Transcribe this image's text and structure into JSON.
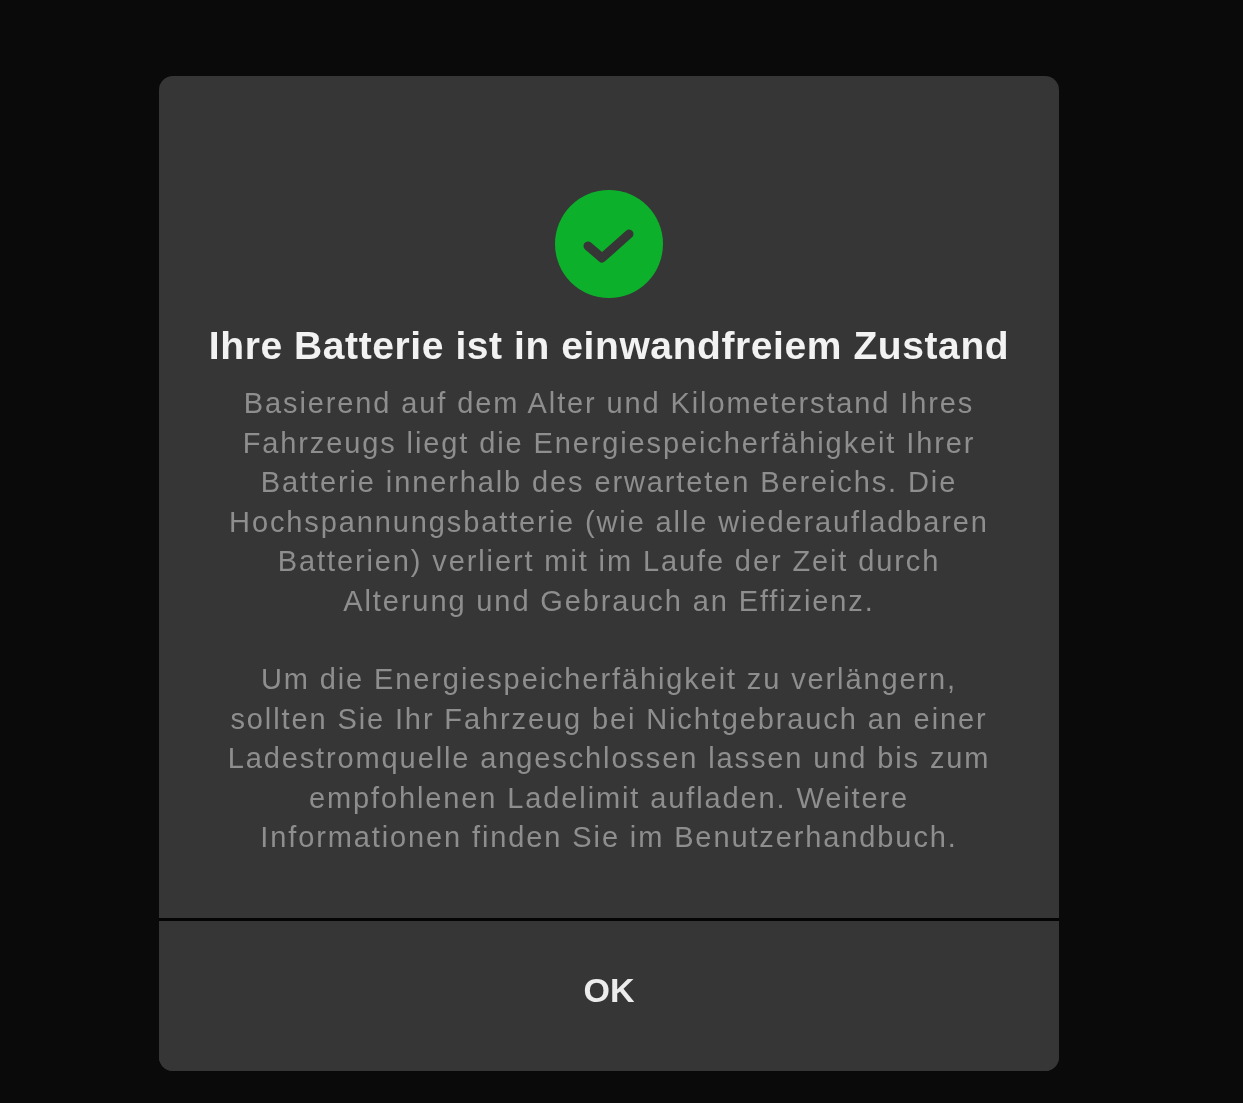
{
  "dialog": {
    "title": "Ihre Batterie ist in einwandfreiem Zustand",
    "paragraphs": [
      "Basierend auf dem Alter und Kilometerstand Ihres Fahrzeugs liegt die Energiespeicherfähigkeit Ihrer Batterie innerhalb des erwarteten Bereichs. Die Hochspannungsbatterie (wie alle wiederaufladbaren Batterien) verliert mit im Laufe der Zeit durch Alterung und Gebrauch an Effizienz.",
      "Um die Energiespeicherfähigkeit zu verlängern, sollten Sie Ihr Fahrzeug bei Nichtgebrauch an einer Ladestromquelle angeschlossen lassen und bis zum empfohlenen Ladelimit aufladen. Weitere Informationen finden Sie im Benutzerhandbuch."
    ],
    "buttons": [
      {
        "label": "OK"
      }
    ]
  }
}
